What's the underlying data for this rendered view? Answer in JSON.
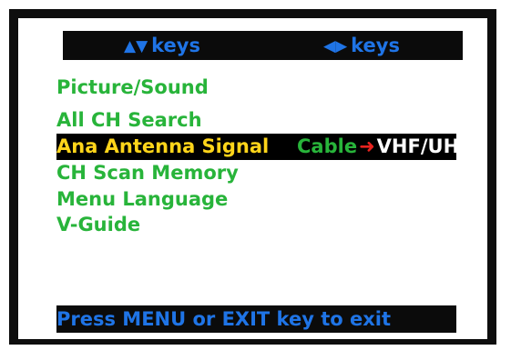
{
  "header": {
    "left_hint": {
      "icon": "up-down-triangle-icon",
      "glyph": "▲▼",
      "label": "keys"
    },
    "right_hint": {
      "icon": "left-right-triangle-icon",
      "glyph": "◀▶",
      "label": "keys"
    }
  },
  "menu": {
    "items": [
      {
        "label": "Picture/Sound"
      },
      {
        "label": "All CH Search"
      },
      {
        "label": "Ana Antenna Signal",
        "selected": true,
        "option_from": "Cable",
        "option_to": "VHF/UHF"
      },
      {
        "label": "CH Scan Memory"
      },
      {
        "label": "Menu Language"
      },
      {
        "label": "V-Guide"
      }
    ]
  },
  "footer": {
    "exit_text": "Press MENU or EXIT key to exit"
  },
  "colors": {
    "menu_text": "#28b43a",
    "selected_text": "#ffd51a",
    "hint_text": "#1f74e6",
    "arrow": "#e8231f",
    "option_to": "#ffffff",
    "bar_bg": "#0b0b0b"
  }
}
